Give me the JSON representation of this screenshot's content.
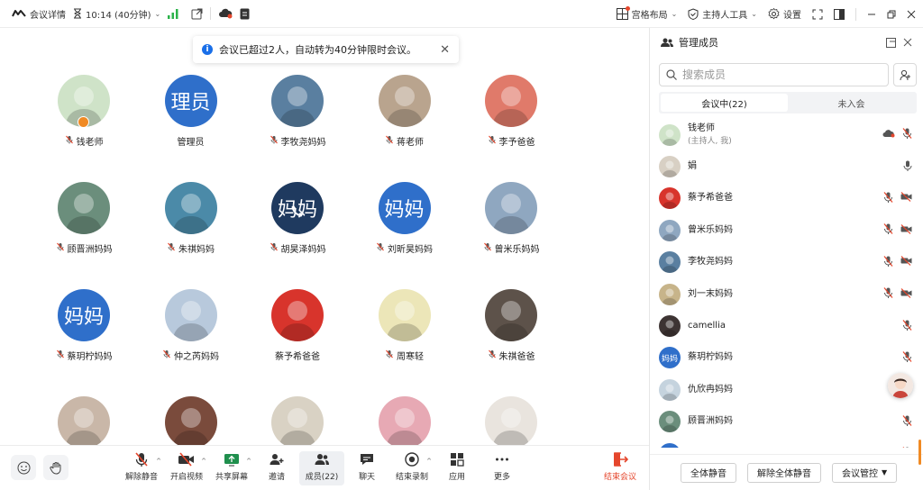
{
  "topbar": {
    "meeting_info": "会议详情",
    "timer": "10:14 (40分钟)",
    "grid_layout": "宫格布局",
    "host_tools": "主持人工具",
    "settings": "设置"
  },
  "notice": {
    "text": "会议已超过2人，自动转为40分钟限时会议。"
  },
  "grid": {
    "tiles": [
      {
        "name": "钱老师",
        "muted": true,
        "avatar_text": "",
        "color": "#cfe3c8",
        "host": true
      },
      {
        "name": "管理员",
        "muted": false,
        "avatar_text": "理员",
        "color": "#2f6fca"
      },
      {
        "name": "李牧尧妈妈",
        "muted": true,
        "avatar_text": "",
        "color": "#5a7fa0"
      },
      {
        "name": "蒋老师",
        "muted": true,
        "avatar_text": "",
        "color": "#b9a48e"
      },
      {
        "name": "李予爸爸",
        "muted": true,
        "avatar_text": "",
        "color": "#e07a6a"
      },
      {
        "name": "顾晋洲妈妈",
        "muted": true,
        "avatar_text": "",
        "color": "#6b8e7c"
      },
      {
        "name": "朱祺妈妈",
        "muted": true,
        "avatar_text": "",
        "color": "#4b8aa8"
      },
      {
        "name": "胡昊泽妈妈",
        "muted": true,
        "avatar_text": "妈妈",
        "color": "#1f3a5f",
        "phone": true
      },
      {
        "name": "刘昕昊妈妈",
        "muted": true,
        "avatar_text": "妈妈",
        "color": "#2f6fca"
      },
      {
        "name": "曾米乐妈妈",
        "muted": true,
        "avatar_text": "",
        "color": "#8fa7c0"
      },
      {
        "name": "蔡玥柠妈妈",
        "muted": true,
        "avatar_text": "妈妈",
        "color": "#2f6fca"
      },
      {
        "name": "仲之芮妈妈",
        "muted": true,
        "avatar_text": "",
        "color": "#b8c9dc"
      },
      {
        "name": "蔡予希爸爸",
        "muted": false,
        "avatar_text": "",
        "color": "#d8342c"
      },
      {
        "name": "周寒轻",
        "muted": true,
        "avatar_text": "",
        "color": "#ece6b8"
      },
      {
        "name": "朱祺爸爸",
        "muted": true,
        "avatar_text": "",
        "color": "#5d524a"
      },
      {
        "name": "",
        "muted": false,
        "avatar_text": "",
        "color": "#c9b7a8"
      },
      {
        "name": "",
        "muted": false,
        "avatar_text": "",
        "color": "#7a4b3c"
      },
      {
        "name": "",
        "muted": false,
        "avatar_text": "",
        "color": "#d9d2c4"
      },
      {
        "name": "",
        "muted": false,
        "avatar_text": "",
        "color": "#e7a9b4"
      },
      {
        "name": "",
        "muted": false,
        "avatar_text": "",
        "color": "#e9e4de"
      }
    ]
  },
  "panel": {
    "title": "管理成员",
    "search_placeholder": "搜索成员",
    "tab_in_meeting": "会议中(22)",
    "tab_not_joined": "未入会",
    "members": [
      {
        "name": "钱老师",
        "sub": "(主持人, 我)",
        "color": "#cfe3c8",
        "text": "",
        "cam_off": false,
        "mic": "off",
        "cloud": true
      },
      {
        "name": "娟",
        "sub": "",
        "color": "#d8d0c4",
        "text": "",
        "cam_off": false,
        "mic": "on"
      },
      {
        "name": "蔡予希爸爸",
        "sub": "",
        "color": "#d8342c",
        "text": "",
        "cam_off": true,
        "mic": "off"
      },
      {
        "name": "曾米乐妈妈",
        "sub": "",
        "color": "#8fa7c0",
        "text": "",
        "cam_off": true,
        "mic": "off"
      },
      {
        "name": "李牧尧妈妈",
        "sub": "",
        "color": "#5a7fa0",
        "text": "",
        "cam_off": true,
        "mic": "off"
      },
      {
        "name": "刘一末妈妈",
        "sub": "",
        "color": "#c7b48a",
        "text": "",
        "cam_off": true,
        "mic": "off"
      },
      {
        "name": "camellia",
        "sub": "",
        "color": "#3d3433",
        "text": "",
        "cam_off": false,
        "mic": "off"
      },
      {
        "name": "蔡玥柠妈妈",
        "sub": "",
        "color": "#2f6fca",
        "text": "妈妈",
        "cam_off": false,
        "mic": "off"
      },
      {
        "name": "仇欣冉妈妈",
        "sub": "",
        "color": "#c5d3de",
        "text": "",
        "cam_off": false,
        "mic": "none"
      },
      {
        "name": "顾晋洲妈妈",
        "sub": "",
        "color": "#6b8e7c",
        "text": "",
        "cam_off": false,
        "mic": "off"
      },
      {
        "name": "",
        "sub": "",
        "color": "#2f6fca",
        "text": "",
        "cam_off": false,
        "mic": "off"
      }
    ],
    "mute_all": "全体静音",
    "unmute_all": "解除全体静音",
    "meeting_control": "会议管控"
  },
  "toolbar": {
    "unmute": "解除静音",
    "start_video": "开启视频",
    "share_screen": "共享屏幕",
    "invite": "邀请",
    "members": "成员(22)",
    "chat": "聊天",
    "end_record": "结束录制",
    "apps": "应用",
    "more": "更多",
    "end_meeting": "结束会议"
  },
  "colors": {
    "accent": "#1a6fe8",
    "danger": "#e5462c",
    "mute_red": "#e5462c",
    "avatar_blue": "#2f6fca"
  }
}
